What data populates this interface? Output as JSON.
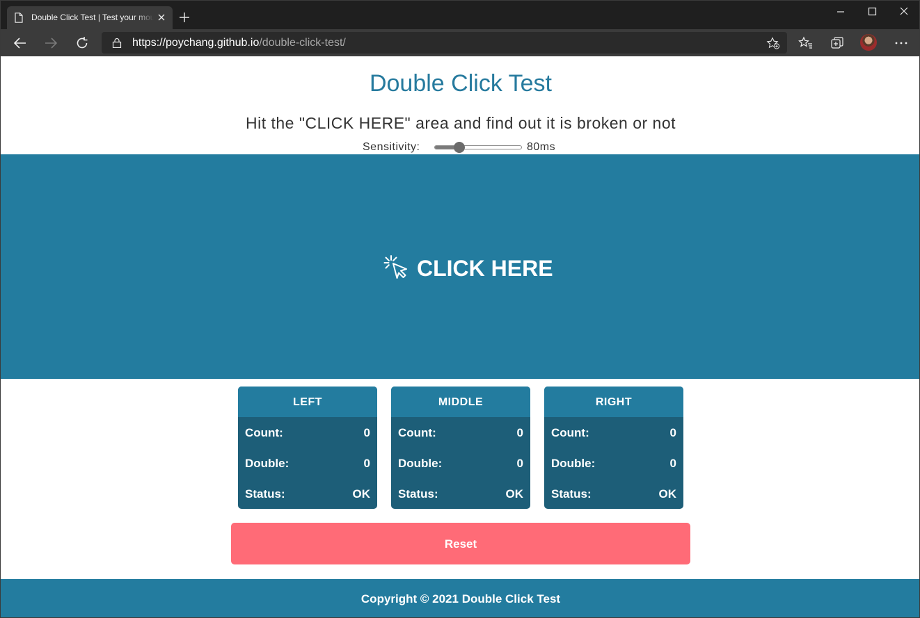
{
  "browser": {
    "tab_title": "Double Click Test | Test your mouse",
    "url_host": "https://poychang.github.io",
    "url_path": "/double-click-test/"
  },
  "page": {
    "title": "Double Click Test",
    "subtitle": "Hit the \"CLICK HERE\" area and find out it is broken or not",
    "sensitivity_label": "Sensitivity:",
    "sensitivity_value": "80ms",
    "sensitivity_level": 0.28,
    "click_label": "CLICK HERE"
  },
  "cards": [
    {
      "title": "LEFT",
      "count_label": "Count:",
      "count": "0",
      "double_label": "Double:",
      "double": "0",
      "status_label": "Status:",
      "status": "OK"
    },
    {
      "title": "MIDDLE",
      "count_label": "Count:",
      "count": "0",
      "double_label": "Double:",
      "double": "0",
      "status_label": "Status:",
      "status": "OK"
    },
    {
      "title": "RIGHT",
      "count_label": "Count:",
      "count": "0",
      "double_label": "Double:",
      "double": "0",
      "status_label": "Status:",
      "status": "OK"
    }
  ],
  "reset_label": "Reset",
  "footer": "Copyright © 2021 Double Click Test",
  "colors": {
    "brand": "#237c9f",
    "card_body": "#1d5e78",
    "reset": "#ff6b77",
    "title": "#267a9e"
  },
  "icons": [
    "page-icon",
    "close-icon",
    "plus-icon",
    "minimize-icon",
    "maximize-icon",
    "window-close-icon",
    "back-icon",
    "forward-icon",
    "refresh-icon",
    "lock-icon",
    "add-favorite-icon",
    "favorites-icon",
    "collections-icon",
    "more-icon",
    "cursor-click-icon"
  ]
}
